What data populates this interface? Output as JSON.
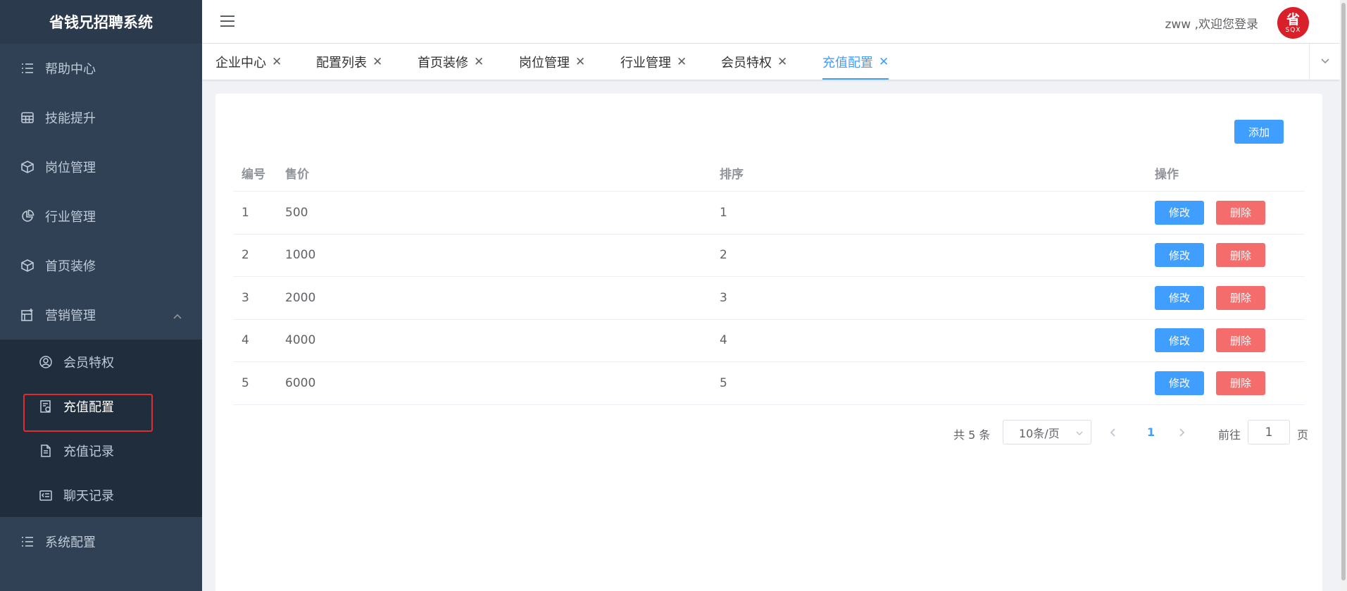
{
  "app": {
    "title": "省钱兄招聘系统"
  },
  "header": {
    "welcome": "zww ,欢迎您登录",
    "avatar_char": "省",
    "avatar_sub": "SQX"
  },
  "sidebar": {
    "items": [
      {
        "label": "帮助中心",
        "icon": "list-icon"
      },
      {
        "label": "技能提升",
        "icon": "grid-icon"
      },
      {
        "label": "岗位管理",
        "icon": "box-icon"
      },
      {
        "label": "行业管理",
        "icon": "pie-chart-icon"
      },
      {
        "label": "首页装修",
        "icon": "box-icon"
      },
      {
        "label": "营销管理",
        "icon": "marketing-icon",
        "expanded": true
      }
    ],
    "sub_items": [
      {
        "label": "会员特权",
        "icon": "user-circle-icon"
      },
      {
        "label": "充值配置",
        "icon": "recharge-config-icon",
        "active": true
      },
      {
        "label": "充值记录",
        "icon": "document-icon"
      },
      {
        "label": "聊天记录",
        "icon": "chat-record-icon"
      }
    ],
    "bottom_item": {
      "label": "系统配置",
      "icon": "list-icon"
    }
  },
  "tabs": [
    {
      "label": "企业中心"
    },
    {
      "label": "配置列表"
    },
    {
      "label": "首页装修"
    },
    {
      "label": "岗位管理"
    },
    {
      "label": "行业管理"
    },
    {
      "label": "会员特权"
    },
    {
      "label": "充值配置",
      "active": true
    }
  ],
  "toolbar": {
    "add_label": "添加"
  },
  "table": {
    "headers": {
      "id": "编号",
      "price": "售价",
      "sort": "排序",
      "ops": "操作"
    },
    "rows": [
      {
        "id": "1",
        "price": "500",
        "sort": "1"
      },
      {
        "id": "2",
        "price": "1000",
        "sort": "2"
      },
      {
        "id": "3",
        "price": "2000",
        "sort": "3"
      },
      {
        "id": "4",
        "price": "4000",
        "sort": "4"
      },
      {
        "id": "5",
        "price": "6000",
        "sort": "5"
      }
    ],
    "edit_label": "修改",
    "delete_label": "删除"
  },
  "pagination": {
    "total": "共 5 条",
    "page_size": "10条/页",
    "current_page": "1",
    "goto_label": "前往",
    "goto_value": "1",
    "page_suffix": "页"
  },
  "colors": {
    "primary": "#409eff",
    "danger": "#f56c6c",
    "sidebar_bg": "#304156",
    "highlight_border": "#e02d2d"
  }
}
